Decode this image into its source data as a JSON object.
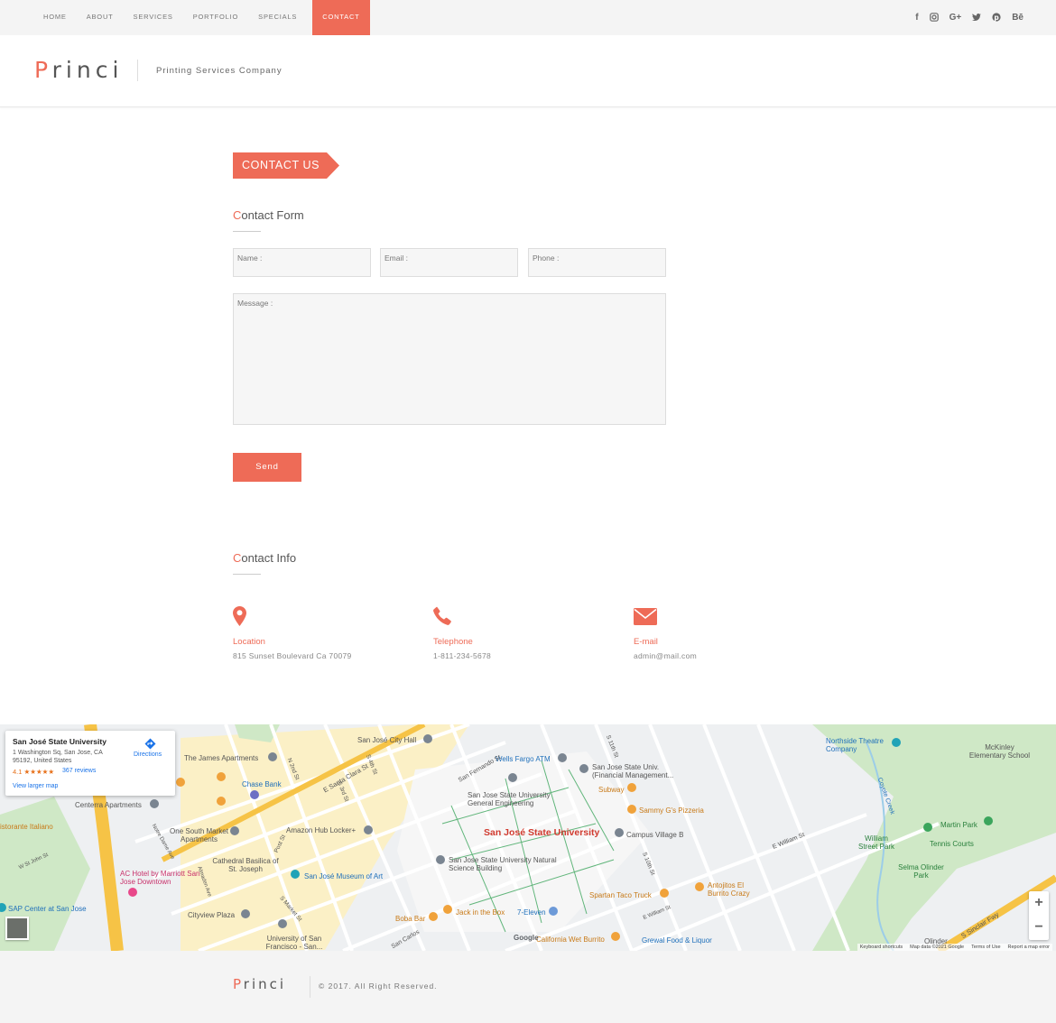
{
  "nav": {
    "items": [
      "HOME",
      "ABOUT",
      "SERVICES",
      "PORTFOLIO",
      "SPECIALS",
      "CONTACT"
    ],
    "active": "CONTACT"
  },
  "social": {
    "facebook": "f",
    "instagram": "◘",
    "googleplus": "G+",
    "twitter": "t",
    "pinterest": "p",
    "behance": "Bē"
  },
  "header": {
    "logo_first": "P",
    "logo_rest": "rinci",
    "tagline": "Printing Services Company"
  },
  "contact": {
    "ribbon": "CONTACT US"
  },
  "form": {
    "title_first": "C",
    "title_rest": "ontact Form",
    "name_ph": "Name :",
    "email_ph": "Email :",
    "phone_ph": "Phone :",
    "message_ph": "Message :",
    "send": "Send"
  },
  "info": {
    "title_first": "C",
    "title_rest": "ontact Info",
    "location_label": "Location",
    "location_value": "815 Sunset Boulevard Ca 70079",
    "telephone_label": "Telephone",
    "telephone_value": "1-811-234-5678",
    "email_label": "E-mail",
    "email_value": "admin@mail.com"
  },
  "map": {
    "card_title": "San José State University",
    "card_address": "1 Washington Sq, San Jose, CA 95192, United States",
    "card_rating": "4.1 ★★★★★",
    "card_reviews": "367 reviews",
    "card_larger": "View larger map",
    "card_directions": "Directions",
    "labels": {
      "l1": "The James Apartments",
      "l2": "San José City Hall",
      "l3": "Wells Fargo ATM",
      "l4": "San Jose State Univ. (Financial Management...",
      "l5": "Northside Theatre Company",
      "l6": "McKinley Elementary School",
      "l7": "Chase Bank",
      "l8": "San Jose State University General Engineering",
      "l9": "Subway",
      "l10": "Sammy G's Pizzeria",
      "l11": "Centerra Apartments",
      "l12": "One South Market Apartments",
      "l13": "Amazon Hub Locker+",
      "l14": "San José State University",
      "l15": "Campus Village B",
      "l16": "Martin Park",
      "l17": "William Street Park",
      "l18": "Tennis Courts",
      "l19": "AC Hotel by Marriott San Jose Downtown",
      "l20": "Cathedral Basilica of St. Joseph",
      "l21": "San José Museum of Art",
      "l22": "San Jose State University Natural Science Building",
      "l23": "Selma Olinder Park",
      "l24": "SAP Center at San Jose",
      "l25": "Cityview Plaza",
      "l26": "Boba Bar",
      "l27": "Jack in the Box",
      "l28": "7-Eleven",
      "l29": "Spartan Taco Truck",
      "l30": "Antojitos El Burrito Crazy",
      "l31": "University of San Francisco - San...",
      "l32": "California Wet Burrito",
      "l33": "Grewal Food & Liquor",
      "l34": "istorante Italiano",
      "l35": "Olinder",
      "s1": "E Santa Clara St",
      "s2": "N 2nd St",
      "s3": "S 3rd St",
      "s4": "S 4th St",
      "s5": "San Fernando St",
      "s6": "E William St",
      "s7": "S 10th St",
      "s8": "S 11th St",
      "s9": "S Market St",
      "s10": "San Carlos",
      "s11": "E William St",
      "s12": "S Sinclair Fwy",
      "s13": "Coyote Creek",
      "s14": "Post St",
      "s15": "Notre Dame Ave",
      "s16": "Almaden Ave",
      "s17": "W St John St"
    },
    "footer": {
      "shortcuts": "Keyboard shortcuts",
      "data": "Map data ©2021 Google",
      "terms": "Terms of Use",
      "report": "Report a map error"
    },
    "google": "Google"
  },
  "footer": {
    "logo_first": "P",
    "logo_rest": "rinci",
    "copyright": "© 2017. All Right Reserved."
  },
  "colors": {
    "accent": "#ee6b57",
    "topbar": "#f4f4f4"
  }
}
